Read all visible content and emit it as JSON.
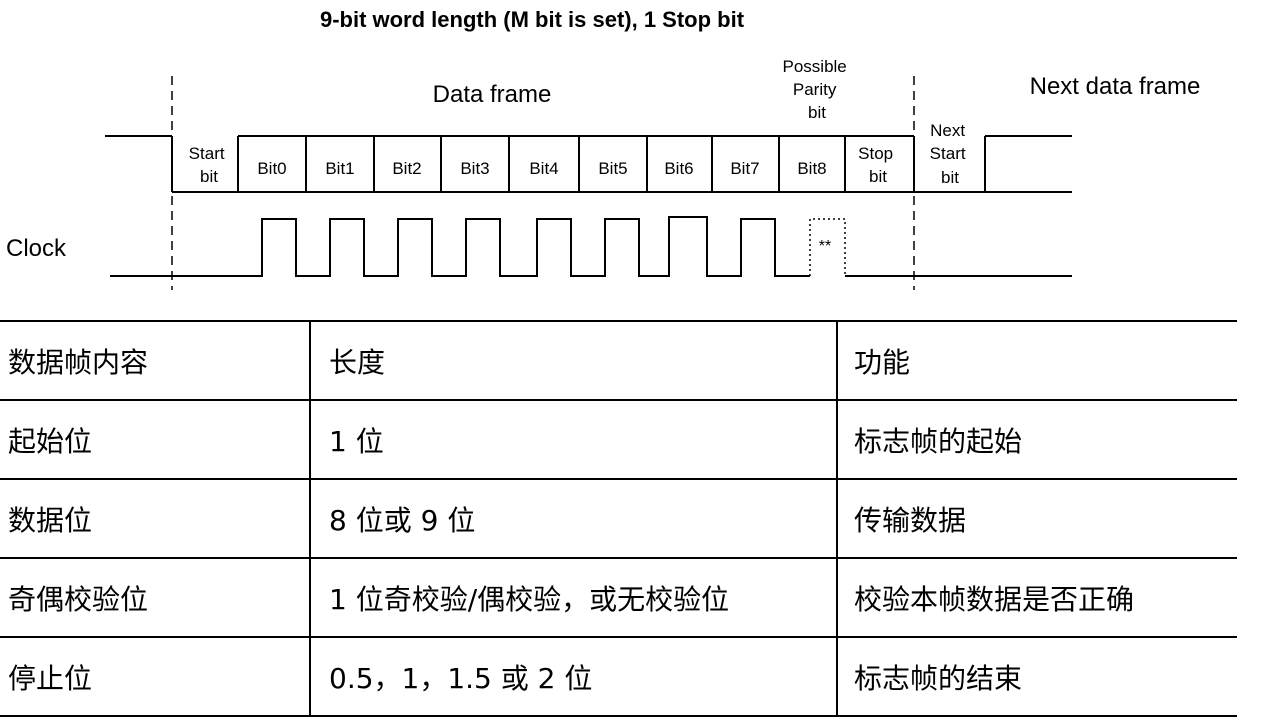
{
  "diagram": {
    "title": "9-bit word length (M bit is set), 1 Stop bit",
    "data_frame_label": "Data frame",
    "parity_label": [
      "Possible",
      "Parity",
      "bit"
    ],
    "next_frame_label": "Next data frame",
    "clock_label": "Clock",
    "clock_marker": "**",
    "start_bit": [
      "Start",
      "bit"
    ],
    "bits": [
      "Bit0",
      "Bit1",
      "Bit2",
      "Bit3",
      "Bit4",
      "Bit5",
      "Bit6",
      "Bit7",
      "Bit8"
    ],
    "stop_bit": [
      "Stop",
      "bit"
    ],
    "next_start_bit": [
      "Next",
      "Start",
      "bit"
    ]
  },
  "table": {
    "header": [
      "数据帧内容",
      "长度",
      "功能"
    ],
    "rows": [
      [
        "起始位",
        "1 位",
        "标志帧的起始"
      ],
      [
        "数据位",
        "8 位或 9 位",
        "传输数据"
      ],
      [
        "奇偶校验位",
        "1 位奇校验/偶校验，或无校验位",
        "校验本帧数据是否正确"
      ],
      [
        "停止位",
        "0.5，1，1.5 或 2 位",
        "标志帧的结束"
      ]
    ]
  }
}
